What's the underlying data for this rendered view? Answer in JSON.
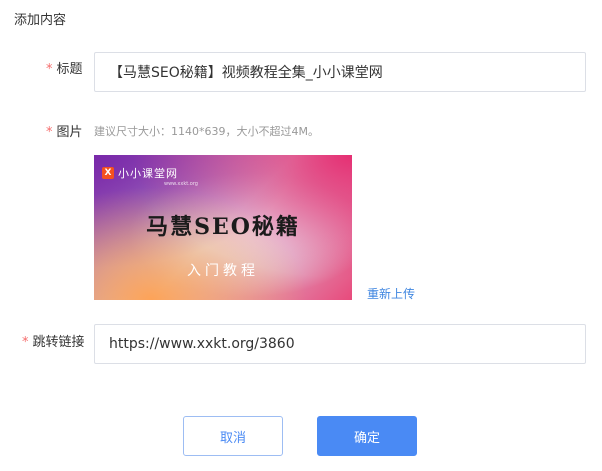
{
  "section_title": "添加内容",
  "form": {
    "title": {
      "required_mark": "*",
      "label": "标题",
      "value": "【马慧SEO秘籍】视频教程全集_小小课堂网"
    },
    "image": {
      "required_mark": "*",
      "label": "图片",
      "hint": "建议尺寸大小：1140*639，大小不超过4M。",
      "thumbnail": {
        "logo_mark": "X",
        "logo_text": "小小课堂网",
        "logo_sub": "www.xxkt.org",
        "title": "马慧SEO秘籍",
        "subtitle": "入门教程"
      },
      "reupload_label": "重新上传"
    },
    "link": {
      "required_mark": "*",
      "label": "跳转链接",
      "value": "https://www.xxkt.org/3860"
    }
  },
  "actions": {
    "cancel_label": "取消",
    "confirm_label": "确定"
  },
  "colors": {
    "accent": "#4a8af4",
    "required": "#f56c6c",
    "link": "#3f86e0"
  }
}
